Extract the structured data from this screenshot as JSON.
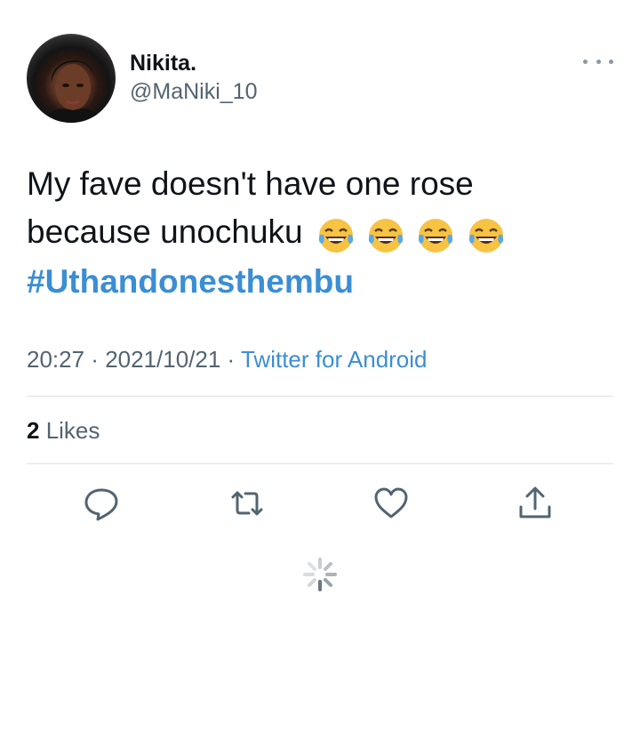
{
  "user": {
    "display_name": "Nikita.",
    "handle": "@MaNiki_10",
    "avatar_icon": "profile-photo"
  },
  "tweet": {
    "line1": "My fave doesn't have one rose",
    "line2": "because unochuku",
    "emoji": [
      "😂",
      "😂",
      "😂",
      "😂"
    ],
    "hashtag": "#Uthandonesthembu"
  },
  "meta": {
    "time": "20:27",
    "separator1": " · ",
    "date": "2021/10/21",
    "separator2": " · ",
    "source": "Twitter for Android"
  },
  "stats": {
    "likes_count": "2",
    "likes_label": " Likes"
  },
  "actions": [
    "reply-icon",
    "retweet-icon",
    "like-icon",
    "share-icon"
  ],
  "colors": {
    "link": "#3b8ed4",
    "secondary_text": "#536471",
    "divider": "#dfe3e6"
  }
}
